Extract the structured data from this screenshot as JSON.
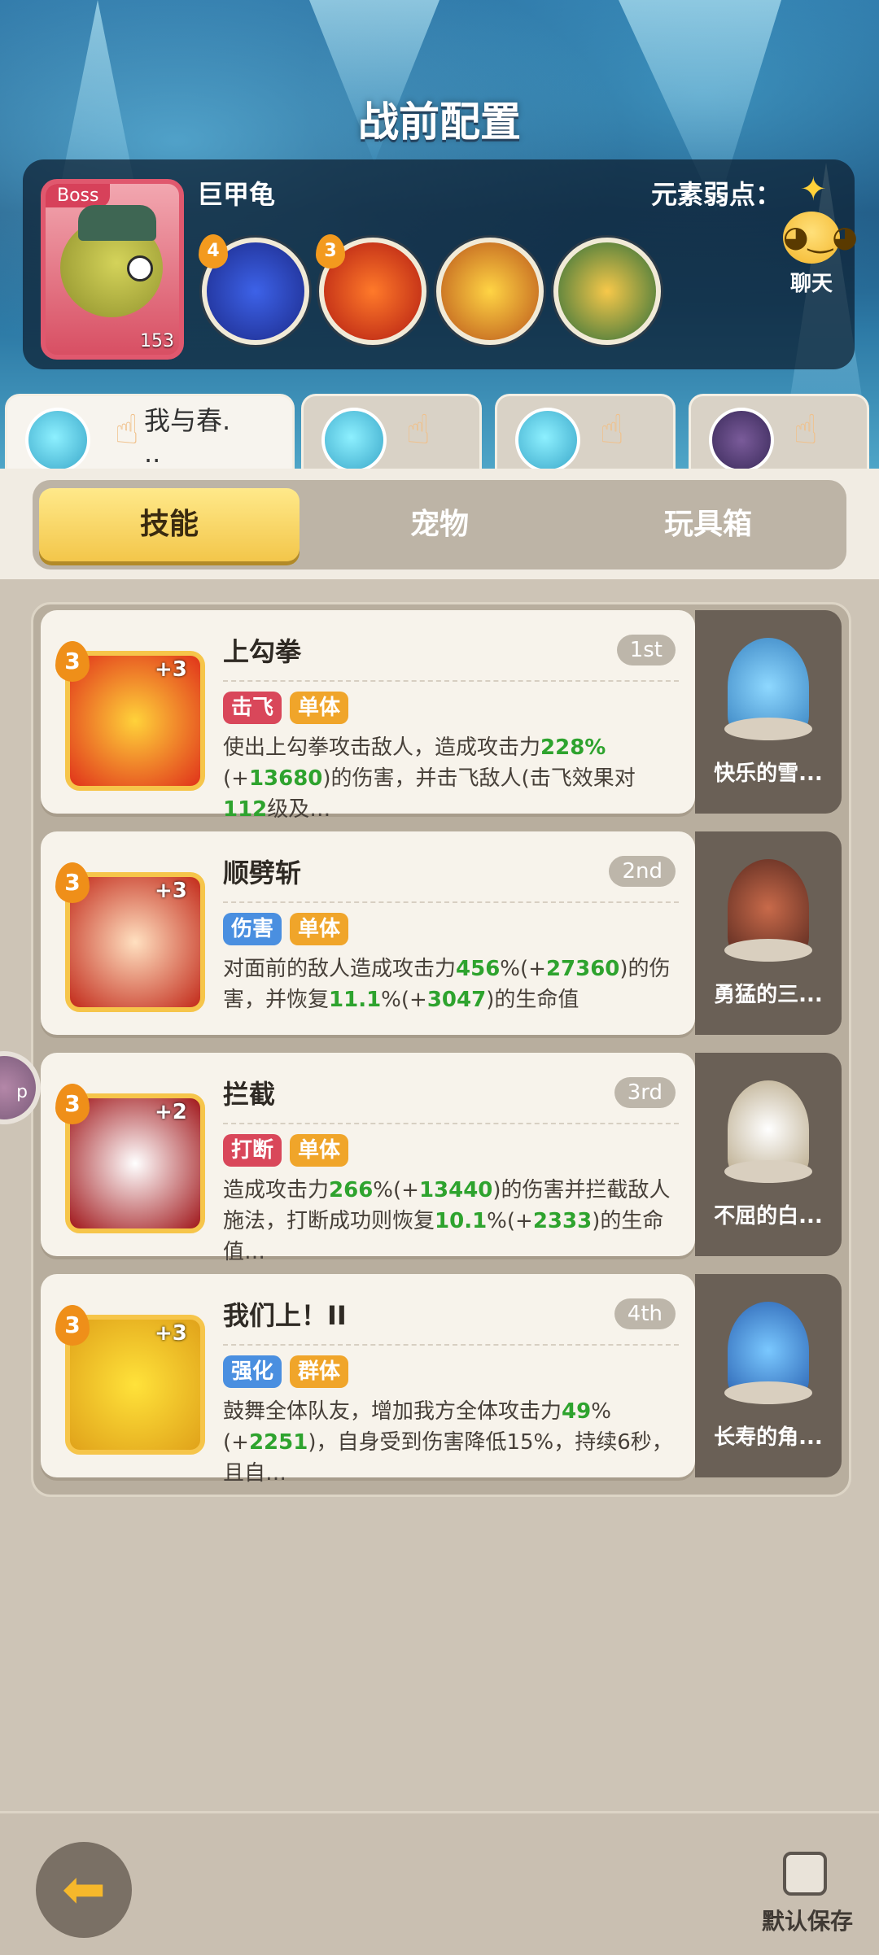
{
  "header": {
    "title": "战前配置"
  },
  "boss": {
    "tag": "Boss",
    "level": "153",
    "name": "巨甲龟",
    "weakness_label": "元素弱点：",
    "weakness_icon": "star-icon",
    "chat_label": "聊天",
    "skill_badges": [
      "4",
      "3",
      "",
      ""
    ]
  },
  "team_tabs": [
    {
      "name": "我与春.\n..",
      "active": true
    },
    {
      "name": "",
      "active": false
    },
    {
      "name": "",
      "active": false
    },
    {
      "name": "",
      "active": false
    }
  ],
  "tabs": [
    "技能",
    "宠物",
    "玩具箱"
  ],
  "active_tab": "技能",
  "skills": [
    {
      "level": "3",
      "plus": "+3",
      "name": "上勾拳",
      "rank": "1st",
      "tags": [
        "击飞",
        "单体"
      ],
      "desc_parts": [
        "使出上勾拳攻击敌人，造成攻击力",
        "228%",
        "(+",
        "13680",
        ")的伤害，并击飞敌人(击飞效果对",
        "112",
        "级及…"
      ],
      "pet_name": "快乐的雪..."
    },
    {
      "level": "3",
      "plus": "+3",
      "name": "顺劈斩",
      "rank": "2nd",
      "tags": [
        "伤害",
        "单体"
      ],
      "desc_parts": [
        "对面前的敌人造成攻击力",
        "456",
        "%(+",
        "27360",
        ")的伤害，并恢复",
        "11.1",
        "%(+",
        "3047",
        ")的生命值"
      ],
      "pet_name": "勇猛的三..."
    },
    {
      "level": "3",
      "plus": "+2",
      "name": "拦截",
      "rank": "3rd",
      "tags": [
        "打断",
        "单体"
      ],
      "desc_parts": [
        "造成攻击力",
        "266",
        "%(+",
        "13440",
        ")的伤害并拦截敌人施法，打断成功则恢复",
        "10.1",
        "%(+",
        "2333",
        ")的生命值…"
      ],
      "pet_name": "不屈的白..."
    },
    {
      "level": "3",
      "plus": "+3",
      "name": "我们上！II",
      "rank": "4th",
      "tags": [
        "强化",
        "群体"
      ],
      "desc_parts": [
        "鼓舞全体队友，增加我方全体攻击力",
        "49",
        "%(+",
        "2251",
        ")，自身受到伤害降低15%，持续6秒，且自…"
      ],
      "pet_name": "长寿的角..."
    }
  ],
  "bottom": {
    "back_icon": "back-arrow-icon",
    "save_label": "默认保存",
    "side_float": "p"
  },
  "colors": {
    "tag_red": "#d9475a",
    "tag_orange": "#f0a52a",
    "tag_blue": "#4a8fe0",
    "highlight_green": "#2ea32e",
    "active_tab_yellow": "#f3c64a"
  }
}
